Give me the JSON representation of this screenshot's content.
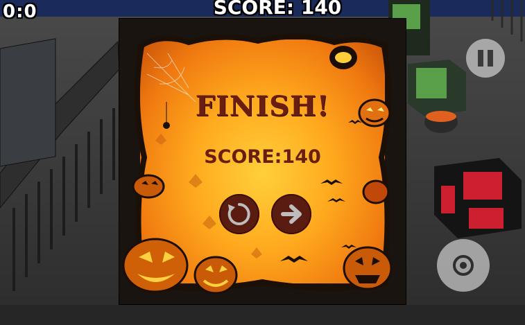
{
  "hud": {
    "timer": "0:0",
    "score_label": "SCORE: 140"
  },
  "popup": {
    "title": "FINISH!",
    "score_text": "SCORE:140"
  },
  "colors": {
    "popup_text": "#6a1e10",
    "button_fill": "#5a1c10",
    "popup_bg_center": "#ffcf3a",
    "popup_bg_edge": "#c85208"
  },
  "icons": {
    "pause": "pause-icon",
    "restart": "restart-icon",
    "next": "arrow-right-icon",
    "joystick": "joystick-icon"
  }
}
